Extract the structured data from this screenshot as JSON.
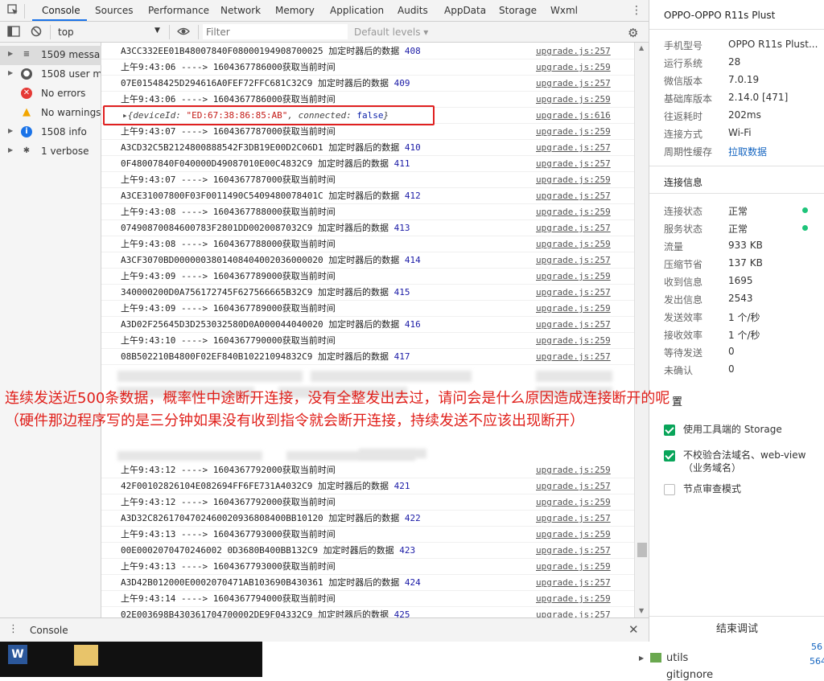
{
  "tabs": [
    "Console",
    "Sources",
    "Performance",
    "Network",
    "Memory",
    "Application",
    "Audits",
    "AppData",
    "Storage",
    "Wxml"
  ],
  "toolbar": {
    "context": "top",
    "filter_placeholder": "Filter",
    "levels": "Default levels ▾"
  },
  "sidebar": {
    "items": [
      {
        "label": "1509 messa...",
        "icon": "list-icon"
      },
      {
        "label": "1508 user m...",
        "icon": "user-icon"
      },
      {
        "label": "No errors",
        "icon": "error-icon"
      },
      {
        "label": "No warnings",
        "icon": "warning-icon"
      },
      {
        "label": "1508 info",
        "icon": "info-icon"
      },
      {
        "label": "1 verbose",
        "icon": "verbose-icon"
      }
    ]
  },
  "console_rows": [
    {
      "text": "A3CC332EE01B48007840F08000194908700025 加定时器后的数据 ",
      "num": "408",
      "src": "upgrade.js:257"
    },
    {
      "text": "上午9:43:06 ----> 1604367786000获取当前时间",
      "num": "",
      "src": "upgrade.js:259"
    },
    {
      "text": "07E01548425D294616A0FEF72FFC681C32C9 加定时器后的数据 ",
      "num": "409",
      "src": "upgrade.js:257"
    },
    {
      "text": "上午9:43:06 ----> 1604367786000获取当前时间",
      "num": "",
      "src": "upgrade.js:259"
    },
    {
      "text": "OBJ",
      "num": "",
      "src": "upgrade.js:616"
    },
    {
      "text": "上午9:43:07 ----> 1604367787000获取当前时间",
      "num": "",
      "src": "upgrade.js:259"
    },
    {
      "text": "A3CD32C5B2124800888542F3DB19E00D2C06D1 加定时器后的数据 ",
      "num": "410",
      "src": "upgrade.js:257"
    },
    {
      "text": "0F48007840F040000D49087010E00C4832C9 加定时器后的数据 ",
      "num": "411",
      "src": "upgrade.js:257"
    },
    {
      "text": "上午9:43:07 ----> 1604367787000获取当前时间",
      "num": "",
      "src": "upgrade.js:259"
    },
    {
      "text": "A3CE31007800F03F0011490C5409480078401C 加定时器后的数据 ",
      "num": "412",
      "src": "upgrade.js:257"
    },
    {
      "text": "上午9:43:08 ----> 1604367788000获取当前时间",
      "num": "",
      "src": "upgrade.js:259"
    },
    {
      "text": "07490870084600783F2801DD0020087032C9 加定时器后的数据 ",
      "num": "413",
      "src": "upgrade.js:257"
    },
    {
      "text": "上午9:43:08 ----> 1604367788000获取当前时间",
      "num": "",
      "src": "upgrade.js:259"
    },
    {
      "text": "A3CF3070BD0000003801408404002036000020 加定时器后的数据 ",
      "num": "414",
      "src": "upgrade.js:257"
    },
    {
      "text": "上午9:43:09 ----> 1604367789000获取当前时间",
      "num": "",
      "src": "upgrade.js:259"
    },
    {
      "text": "340000200D0A756172745F627566665B32C9 加定时器后的数据 ",
      "num": "415",
      "src": "upgrade.js:257"
    },
    {
      "text": "上午9:43:09 ----> 1604367789000获取当前时间",
      "num": "",
      "src": "upgrade.js:259"
    },
    {
      "text": "A3D02F25645D3D253032580D0A000044040020 加定时器后的数据 ",
      "num": "416",
      "src": "upgrade.js:257"
    },
    {
      "text": "上午9:43:10 ----> 1604367790000获取当前时间",
      "num": "",
      "src": "upgrade.js:259"
    },
    {
      "text": "08B502210B4800F02EF840B10221094832C9 加定时器后的数据 ",
      "num": "417",
      "src": "upgrade.js:257"
    }
  ],
  "console_object": {
    "prefix": "▸{deviceId: ",
    "id": "\"ED:67:38:86:85:AB\"",
    "mid": ", connected: ",
    "kw": "false",
    "suffix": "}"
  },
  "console_rows_bottom": [
    {
      "text": "上午9:43:12 ----> 1604367792000获取当前时间",
      "num": "",
      "src": "upgrade.js:259"
    },
    {
      "text": "42F00102826104E082694FF6FE731A4032C9 加定时器后的数据 ",
      "num": "421",
      "src": "upgrade.js:257"
    },
    {
      "text": "上午9:43:12 ----> 1604367792000获取当前时间",
      "num": "",
      "src": "upgrade.js:259"
    },
    {
      "text": "A3D32C8261704702460020936808400BB10120 加定时器后的数据 ",
      "num": "422",
      "src": "upgrade.js:257"
    },
    {
      "text": "上午9:43:13 ----> 1604367793000获取当前时间",
      "num": "",
      "src": "upgrade.js:259"
    },
    {
      "text": "00E0002070470246002 0D3680B400BB132C9 加定时器后的数据 ",
      "num": "423",
      "src": "upgrade.js:257"
    },
    {
      "text": "上午9:43:13 ----> 1604367793000获取当前时间",
      "num": "",
      "src": "upgrade.js:259"
    },
    {
      "text": "A3D42B012000E0002070471AB103690B430361 加定时器后的数据 ",
      "num": "424",
      "src": "upgrade.js:257"
    },
    {
      "text": "上午9:43:14 ----> 1604367794000获取当前时间",
      "num": "",
      "src": "upgrade.js:259"
    },
    {
      "text": "02E003698B430361704700002DE9F04332C9 加定时器后的数据 ",
      "num": "425",
      "src": "upgrade.js:257"
    }
  ],
  "annotation": "连续发送近500条数据，概率性中途断开连接，没有全整发出去过，请问会是什么原因造成连接断开的呢（硬件那边程序写的是三分钟如果没有收到指令就会断开连接，持续发送不应该出现断开）",
  "right_panel": {
    "device_title": "OPPO-OPPO R11s Plust",
    "device_info": [
      {
        "k": "手机型号",
        "v": "OPPO R11s Plust..."
      },
      {
        "k": "运行系统",
        "v": "28"
      },
      {
        "k": "微信版本",
        "v": "7.0.19"
      },
      {
        "k": "基础库版本",
        "v": "2.14.0 [471]"
      },
      {
        "k": "往返耗时",
        "v": "202ms"
      },
      {
        "k": "连接方式",
        "v": "Wi-Fi"
      },
      {
        "k": "周期性缓存",
        "v": "拉取数据"
      }
    ],
    "conn_title": "连接信息",
    "conn_info": [
      {
        "k": "连接状态",
        "v": "正常"
      },
      {
        "k": "服务状态",
        "v": "正常"
      },
      {
        "k": "流量",
        "v": "933 KB"
      },
      {
        "k": "压缩节省",
        "v": "137 KB"
      },
      {
        "k": "收到信息",
        "v": "1695"
      },
      {
        "k": "发出信息",
        "v": "2543"
      },
      {
        "k": "发送效率",
        "v": "1 个/秒"
      },
      {
        "k": "接收效率",
        "v": "1 个/秒"
      },
      {
        "k": "等待发送",
        "v": "0"
      },
      {
        "k": "未确认",
        "v": "0"
      }
    ],
    "settings_title": "置",
    "settings": [
      {
        "label": "使用工具端的 Storage",
        "checked": true
      },
      {
        "label": "不校验合法域名、web-view（业务域名）",
        "checked": true
      },
      {
        "label": "节点审查模式",
        "checked": false
      }
    ],
    "end_button": "结束调试"
  },
  "drawer": {
    "label": "Console"
  },
  "filetree": {
    "items": [
      "utils",
      "gitignore"
    ],
    "numbers": [
      "56",
      "564"
    ]
  },
  "colors": {
    "accent": "#1a73e8",
    "annotation": "#e0201b",
    "status_ok": "#1ec47a",
    "check": "#09a55a",
    "highlight_box": "#e02020"
  }
}
